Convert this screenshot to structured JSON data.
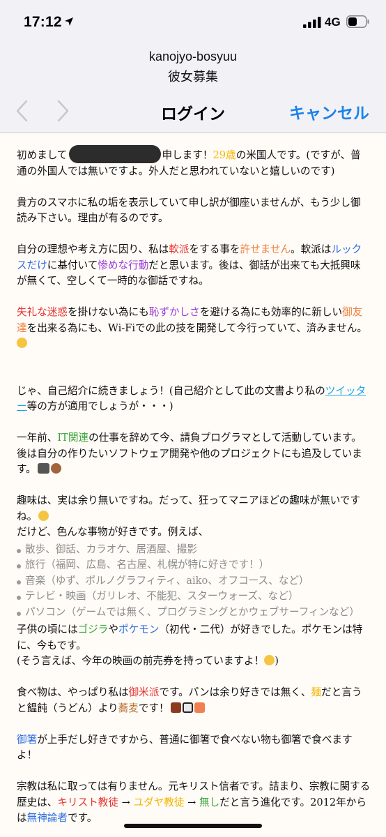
{
  "status": {
    "time": "17:12",
    "network": "4G"
  },
  "header": {
    "site": "kanojyo-bosyuu",
    "title_jp": "彼女募集"
  },
  "nav": {
    "title": "ログイン",
    "cancel": "キャンセル"
  },
  "article": {
    "p1_a": "初めまして",
    "p1_b": "申します！",
    "p1_age": "29歳",
    "p1_c": "の米国人です。(ですが、普通の外国人では無いですよ。外人だと思われていないと嬉しいのです)",
    "p2": "貴方のスマホに私の垢を表示していて申し訳が御座いませんが、もう少し御読み下さい。理由が有るのです。",
    "p3_a": "自分の理想や考え方に因り、私は",
    "p3_soft": "軟派",
    "p3_b": "をする事を",
    "p3_forgive": "許せません",
    "p3_c": "。軟派は",
    "p3_looks": "ルックスだけ",
    "p3_d": "に基付いて",
    "p3_miserable": "惨めな行動",
    "p3_e": "だと思います。後は、御話が出来ても大抵興味が無くて、空しくて一時的な御話ですね。",
    "p4_rude": "失礼な迷惑",
    "p4_a": "を掛けない為にも",
    "p4_shame": "恥ずかしさ",
    "p4_b": "を避ける為にも効率的に新しい",
    "p4_friends": "御友達",
    "p4_c": "を出来る為にも、Wi-Fiでの此の技を開発して今行っていて、済みません。",
    "p5_a": "じゃ、自己紹介に続きましょう！(自己紹介として此の文書より私の",
    "p5_twitter": "ツイッター",
    "p5_b": "等の方が適用でしょうが・・・)",
    "p6_a": "一年前、",
    "p6_it": "IT関連",
    "p6_b": "の仕事を辞めて今、請負プログラマとして活動しています。後は自分の作りたいソフトウェア開発や他のプロジェクトにも追及しています。",
    "p7_a": "趣味は、実は余り無いですね。だって、狂ってマニアほどの趣味が無いですね。",
    "p7_b": "だけど、色んな事物が好きです。例えば、",
    "hobbies": [
      "散歩、御話、カラオケ、居酒屋、撮影",
      "旅行（福岡、広島、名古屋、札幌が特に好きです！）",
      "音楽（ゆず、ポルノグラフィティ、aiko、オフコース、など）",
      "テレビ・映画（ガリレオ、不能犯、スターウォーズ、など）",
      "パソコン（ゲームでは無く、プログラミングとかウェブサーフィンなど）"
    ],
    "p8_a": "子供の頃には",
    "p8_godzilla": "ゴジラ",
    "p8_b": "や",
    "p8_pokemon": "ポケモン",
    "p8_c": "（初代・二代）が好きでした。ポケモンは特に、今もです。",
    "p8_d": "(そう言えば、今年の映画の前売券を持っていますよ！",
    "p8_e": ")",
    "p9_a": "食べ物は、やっぱり私は",
    "p9_rice": "御米派",
    "p9_b": "です。パンは余り好きでは無く、",
    "p9_noodle": "麺",
    "p9_c": "だと言うと饂飩（うどん）より",
    "p9_soba": "蕎麦",
    "p9_d": "です！",
    "p10_chopsticks": "御箸",
    "p10_a": "が上手だし好きですから、普通に御箸で食べない物も御箸で食べますよ！",
    "p11_a": "宗教は私に取っては有りません。元キリスト信者です。詰まり、宗教に関する歴史は、",
    "p11_christian": "キリスト教徒",
    "p11_arrow1": " → ",
    "p11_jewish": "ユダヤ教徒",
    "p11_arrow2": " → ",
    "p11_none": "無し",
    "p11_b": "だと言う進化です。2012年からは",
    "p11_atheist": "無神論者",
    "p11_c": "です。"
  },
  "icons": {
    "status": [
      "location-arrow-icon",
      "signal-icon",
      "battery-icon"
    ],
    "nav": [
      "back-chevron-icon",
      "forward-chevron-icon"
    ],
    "emoji": [
      "disappointed-face-emoji",
      "laptop-emoji",
      "squirrel-emoji",
      "sweat-smile-emoji",
      "grinning-face-emoji",
      "bento-emoji",
      "onigiri-emoji",
      "sushi-emoji"
    ]
  },
  "colors": {
    "accent": "#1a82ec",
    "yellow": "#f4b400",
    "red": "#e53232",
    "orange": "#f07d3a",
    "blue": "#2f6fe0",
    "purple": "#9c3bd9",
    "green": "#3aa53a",
    "cyan": "#1aa4e8"
  }
}
